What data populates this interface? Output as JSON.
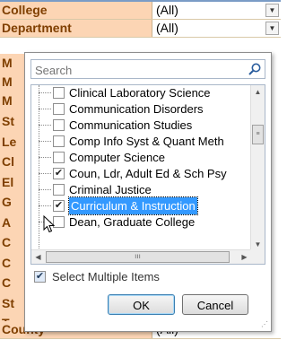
{
  "filters": [
    {
      "label": "College",
      "value": "(All)"
    },
    {
      "label": "Department",
      "value": "(All)"
    }
  ],
  "bottom_filter": {
    "label": "County",
    "value": "(All)"
  },
  "left_letters": [
    "M",
    "M",
    "M",
    "St",
    "Le",
    "Cl",
    "El",
    "G",
    "A",
    "C",
    "C",
    "C",
    "St",
    "T"
  ],
  "panel": {
    "search_placeholder": "Search",
    "items": [
      {
        "label": "Clinical Laboratory Science",
        "checked": false
      },
      {
        "label": "Communication Disorders",
        "checked": false
      },
      {
        "label": "Communication Studies",
        "checked": false
      },
      {
        "label": "Comp Info Syst & Quant Meth",
        "checked": false
      },
      {
        "label": "Computer Science",
        "checked": false
      },
      {
        "label": "Coun, Ldr, Adult Ed & Sch Psy",
        "checked": true
      },
      {
        "label": "Criminal Justice",
        "checked": false
      },
      {
        "label": "Curriculum & Instruction",
        "checked": true
      },
      {
        "label": "Dean, Graduate College",
        "checked": false
      }
    ],
    "select_multiple_label": "Select Multiple Items",
    "select_multiple_checked": true,
    "ok_label": "OK",
    "cancel_label": "Cancel"
  },
  "colors": {
    "header_bg": "#fcd5b4",
    "header_text": "#7f3f00",
    "selection": "#3399ff"
  }
}
